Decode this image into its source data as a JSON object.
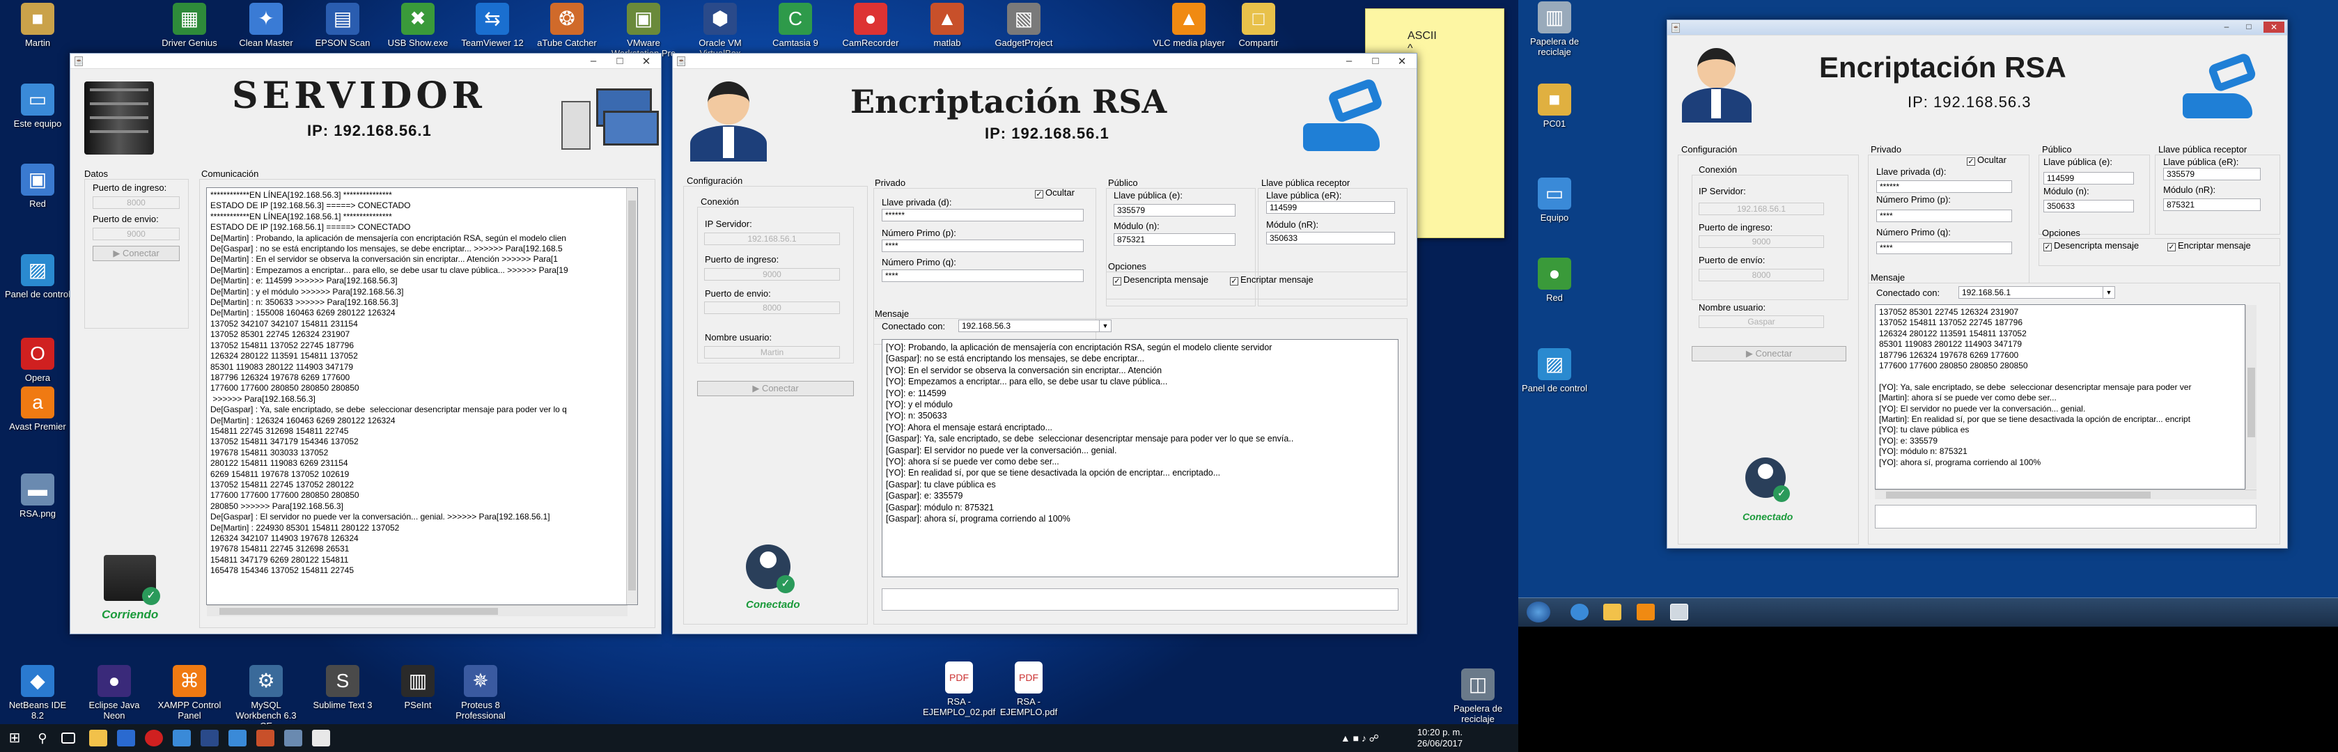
{
  "desktop_icons_top": [
    {
      "label": "Martin",
      "glyph": "■",
      "color": "#caa24a"
    },
    {
      "label": "Driver Genius",
      "glyph": "▦",
      "color": "#2e8b3a"
    },
    {
      "label": "Clean Master",
      "glyph": "✦",
      "color": "#3a7bd5"
    },
    {
      "label": "EPSON Scan",
      "glyph": "▤",
      "color": "#2a5db0"
    },
    {
      "label": "USB Show.exe",
      "glyph": "✖",
      "color": "#3a9a3a"
    },
    {
      "label": "TeamViewer 12",
      "glyph": "⇆",
      "color": "#1a6fd0"
    },
    {
      "label": "aTube Catcher",
      "glyph": "❂",
      "color": "#d06a2a"
    },
    {
      "label": "VMware Workstation Pro",
      "glyph": "▣",
      "color": "#6a8a3a"
    },
    {
      "label": "Oracle VM VirtualBox",
      "glyph": "⬢",
      "color": "#2a4a8a"
    },
    {
      "label": "Camtasia 9",
      "glyph": "C",
      "color": "#2e9a4a"
    },
    {
      "label": "CamRecorder",
      "glyph": "●",
      "color": "#d33"
    },
    {
      "label": "matlab",
      "glyph": "▲",
      "color": "#c8502a"
    },
    {
      "label": "GadgetProject",
      "glyph": "▧",
      "color": "#7a7a7a"
    },
    {
      "label": "VLC media player",
      "glyph": "▲",
      "color": "#f08a12"
    },
    {
      "label": "Compartir",
      "glyph": "□",
      "color": "#e8c14a"
    }
  ],
  "desktop_icons_left": [
    {
      "label": "Este equipo",
      "glyph": "▭",
      "color": "#3a8ad8"
    },
    {
      "label": "Red",
      "glyph": "▣",
      "color": "#3a7ad0"
    },
    {
      "label": "Panel de control",
      "glyph": "▨",
      "color": "#2a8ad0"
    },
    {
      "label": "Opera",
      "glyph": "O",
      "color": "#d02020"
    },
    {
      "label": "Avast Premier",
      "glyph": "a",
      "color": "#f07a12"
    },
    {
      "label": "RSA.png",
      "glyph": "▬",
      "color": "#6a8ab0"
    }
  ],
  "desktop_icons_bottom": [
    {
      "label": "NetBeans IDE 8.2",
      "glyph": "◆",
      "color": "#2a7ad0"
    },
    {
      "label": "Eclipse Java Neon",
      "glyph": "●",
      "color": "#3a2a7a"
    },
    {
      "label": "XAMPP Control Panel",
      "glyph": "⌘",
      "color": "#f07a12"
    },
    {
      "label": "MySQL Workbench 6.3 CE",
      "glyph": "⚙",
      "color": "#3a6a9a"
    },
    {
      "label": "Sublime Text 3",
      "glyph": "S",
      "color": "#4a4a4a"
    },
    {
      "label": "PSeInt",
      "glyph": "▥",
      "color": "#2a2a2a"
    },
    {
      "label": "Proteus 8 Professional",
      "glyph": "✵",
      "color": "#3a5aa0"
    }
  ],
  "desktop_files": [
    {
      "label": "RSA - EJEMPLO_02.pdf"
    },
    {
      "label": "RSA - EJEMPLO.pdf"
    }
  ],
  "recycle_main": "Papelera de reciclaje",
  "sticky_note": {
    "lines": [
      "ASCII",
      "^",
      "^",
      "⊘",
      "",
      "{",
      "}"
    ]
  },
  "servidor": {
    "title": "SERVIDOR",
    "ip": "IP: 192.168.56.1",
    "datos_label": "Datos",
    "puerto_ingreso_label": "Puerto de ingreso:",
    "puerto_ingreso_value": "8000",
    "puerto_envio_label": "Puerto de envio:",
    "puerto_envio_value": "9000",
    "conectar_label": "Conectar",
    "comunicacion_label": "Comunicación",
    "status": "Corriendo",
    "log": "************EN LÍNEA[192.168.56.3] ***************\nESTADO DE IP [192.168.56.3] =====> CONECTADO\n************EN LÍNEA[192.168.56.1] ***************\nESTADO DE IP [192.168.56.1] =====> CONECTADO\nDe[Martin] : Probando, la aplicación de mensajería con encriptación RSA, según el modelo clien\nDe[Gaspar] : no se está encriptando los mensajes, se debe encriptar... >>>>>> Para[192.168.5\nDe[Martin] : En el servidor se observa la conversación sin encriptar... Atención >>>>>> Para[1\nDe[Martin] : Empezamos a encriptar... para ello, se debe usar tu clave pública... >>>>>> Para[19\nDe[Martin] : e: 114599 >>>>>> Para[192.168.56.3]\nDe[Martin] : y el módulo >>>>>> Para[192.168.56.3]\nDe[Martin] : n: 350633 >>>>>> Para[192.168.56.3]\nDe[Martin] : 155008 160463 6269 280122 126324\n137052 342107 342107 154811 231154\n137052 85301 22745 126324 231907\n137052 154811 137052 22745 187796\n126324 280122 113591 154811 137052\n85301 119083 280122 114903 347179\n187796 126324 197678 6269 177600\n177600 177600 280850 280850 280850\n >>>>>> Para[192.168.56.3]\nDe[Gaspar] : Ya, sale encriptado, se debe  seleccionar desencriptar mensaje para poder ver lo q\nDe[Martin] : 126324 160463 6269 280122 126324\n154811 22745 312698 154811 22745\n137052 154811 347179 154346 137052\n197678 154811 303033 137052\n280122 154811 119083 6269 231154\n6269 154811 197678 137052 102619\n137052 154811 22745 137052 280122\n177600 177600 177600 280850 280850\n280850 >>>>>> Para[192.168.56.3]\nDe[Gaspar] : El servidor no puede ver la conversación... genial. >>>>>> Para[192.168.56.1]\nDe[Martin] : 224930 85301 154811 280122 137052\n126324 342107 114903 197678 126324\n197678 154811 22745 312698 26531\n154811 347179 6269 280122 154811\n165478 154346 137052 154811 22745"
  },
  "cliente_martin": {
    "title": "Encriptación RSA",
    "ip": "IP: 192.168.56.1",
    "configuracion_label": "Configuración",
    "conexion_label": "Conexión",
    "ip_servidor_label": "IP Servidor:",
    "ip_servidor_value": "192.168.56.1",
    "puerto_ingreso_label": "Puerto de ingreso:",
    "puerto_ingreso_value": "9000",
    "puerto_envio_label": "Puerto de envio:",
    "puerto_envio_value": "8000",
    "usuario_label": "Nombre usuario:",
    "usuario_value": "Martin",
    "conectar_label": "Conectar",
    "status": "Conectado",
    "privado_label": "Privado",
    "ocultar_label": "Ocultar",
    "llave_privada_label": "Llave privada (d):",
    "llave_privada_value": "******",
    "primo_p_label": "Número Primo (p):",
    "primo_p_value": "****",
    "primo_q_label": "Número Primo (q):",
    "primo_q_value": "****",
    "publico_label": "Público",
    "llave_publica_label": "Llave pública (e):",
    "llave_publica_value": "335579",
    "modulo_label": "Módulo (n):",
    "modulo_value": "875321",
    "receptor_label": "Llave pública receptor",
    "llave_receptor_label": "Llave pública (eR):",
    "llave_receptor_value": "114599",
    "modulo_receptor_label": "Módulo (nR):",
    "modulo_receptor_value": "350633",
    "opciones_label": "Opciones",
    "desencripta_label": "Desencripta mensaje",
    "encriptar_label": "Encriptar mensaje",
    "mensaje_label": "Mensaje",
    "conectado_con_label": "Conectado con:",
    "conectado_con_value": "192.168.56.3",
    "log": "[YO]: Probando, la aplicación de mensajería con encriptación RSA, según el modelo cliente servidor\n[Gaspar]: no se está encriptando los mensajes, se debe encriptar...\n[YO]: En el servidor se observa la conversación sin encriptar... Atención\n[YO]: Empezamos a encriptar... para ello, se debe usar tu clave pública...\n[YO]: e: 114599\n[YO]: y el módulo\n[YO]: n: 350633\n[YO]: Ahora el mensaje estará encriptado...\n[Gaspar]: Ya, sale encriptado, se debe  seleccionar desencriptar mensaje para poder ver lo que se envía..\n[Gaspar]: El servidor no puede ver la conversación... genial.\n[YO]: ahora sí se puede ver como debe ser...\n[YO]: En realidad sí, por que se tiene desactivada la opción de encriptar... encriptado...\n[Gaspar]: tu clave pública es\n[Gaspar]: e: 335579\n[Gaspar]: módulo n: 875321\n[Gaspar]: ahora sí, programa corriendo al 100%",
    "input_value": ""
  },
  "cliente_gaspar": {
    "title": "Encriptación RSA",
    "ip": "IP: 192.168.56.3",
    "configuracion_label": "Configuración",
    "conexion_label": "Conexión",
    "ip_servidor_label": "IP Servidor:",
    "ip_servidor_value": "192.168.56.1",
    "puerto_ingreso_label": "Puerto de ingreso:",
    "puerto_ingreso_value": "9000",
    "puerto_envio_label": "Puerto de envío:",
    "puerto_envio_value": "8000",
    "usuario_label": "Nombre usuario:",
    "usuario_value": "Gaspar",
    "conectar_label": "Conectar",
    "status": "Conectado",
    "privado_label": "Privado",
    "ocultar_label": "Ocultar",
    "llave_privada_label": "Llave privada (d):",
    "llave_privada_value": "******",
    "primo_p_label": "Número Primo (p):",
    "primo_p_value": "****",
    "primo_q_label": "Número Primo (q):",
    "primo_q_value": "****",
    "publico_label": "Público",
    "llave_publica_label": "Llave pública (e):",
    "llave_publica_value": "114599",
    "modulo_label": "Módulo (n):",
    "modulo_value": "350633",
    "receptor_label": "Llave pública receptor",
    "llave_receptor_label": "Llave pública (eR):",
    "llave_receptor_value": "335579",
    "modulo_receptor_label": "Módulo (nR):",
    "modulo_receptor_value": "875321",
    "opciones_label": "Opciones",
    "desencripta_label": "Desencripta mensaje",
    "encriptar_label": "Encriptar mensaje",
    "mensaje_label": "Mensaje",
    "conectado_con_label": "Conectado con:",
    "conectado_con_value": "192.168.56.1",
    "log": "137052 85301 22745 126324 231907\n137052 154811 137052 22745 187796\n126324 280122 113591 154811 137052\n85301 119083 280122 114903 347179\n187796 126324 197678 6269 177600\n177600 177600 280850 280850 280850\n\n[YO]: Ya, sale encriptado, se debe  seleccionar desencriptar mensaje para poder ver\n[Martin]: ahora sí se puede ver como debe ser...\n[YO]: El servidor no puede ver la conversación... genial.\n[Martin]: En realidad sí, por que se tiene desactivada la opción de encriptar... encript\n[YO]: tu clave pública es\n[YO]: e: 335579\n[YO]: módulo n: 875321\n[YO]: ahora sí, programa corriendo al 100%",
    "input_value": ""
  },
  "vm_icons": [
    {
      "label": "Papelera de reciclaje",
      "glyph": "▥",
      "color": "#9ab"
    },
    {
      "label": "PC01",
      "glyph": "■",
      "color": "#e0b040"
    },
    {
      "label": "Equipo",
      "glyph": "▭",
      "color": "#3a8ad8"
    },
    {
      "label": "Red",
      "glyph": "●",
      "color": "#3a9a3a"
    },
    {
      "label": "Panel de control",
      "glyph": "▨",
      "color": "#2a8ad0"
    }
  ],
  "tray": {
    "time": "10:20 p. m.",
    "date": "26/06/2017"
  }
}
